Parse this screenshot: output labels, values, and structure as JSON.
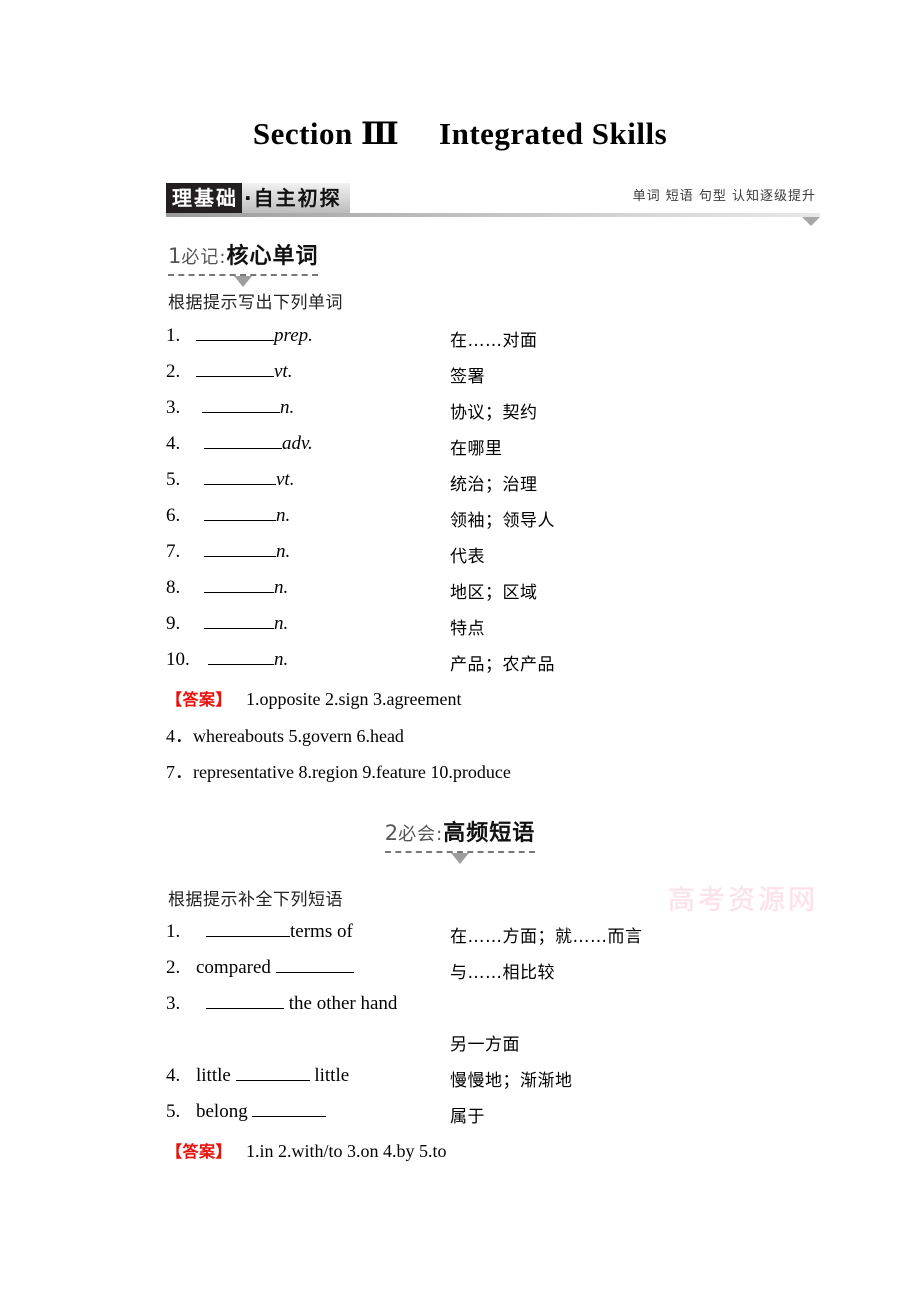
{
  "page": {
    "title": "Section Ⅲ  Integrated Skills"
  },
  "banner": {
    "tag_dark": "理基础",
    "tag_light": "·自主初探",
    "caption": "单词 短语 句型  认知逐级提升",
    "triangle_color": "#a8a8a8"
  },
  "watermark": {
    "text": "高考资源网",
    "color": "#f9c9d8"
  },
  "section1": {
    "num": "1",
    "pre": "必记:",
    "main": "核心单词",
    "prompt": "根据提示写出下列单词",
    "items": [
      {
        "num": "1.",
        "pos": "prep.",
        "blank_width": 78,
        "gap": 0,
        "cn": "在……对面"
      },
      {
        "num": "2.",
        "pos": "vt.",
        "blank_width": 78,
        "gap": 0,
        "cn": "签署"
      },
      {
        "num": "3.",
        "pos": "n.",
        "blank_width": 78,
        "gap": 6,
        "cn": "协议；契约"
      },
      {
        "num": "4.",
        "pos": "adv.",
        "blank_width": 78,
        "gap": 8,
        "cn": "在哪里"
      },
      {
        "num": "5.",
        "pos": "vt.",
        "blank_width": 72,
        "gap": 8,
        "cn": "统治；治理"
      },
      {
        "num": "6.",
        "pos": "n.",
        "blank_width": 72,
        "gap": 8,
        "cn": "领袖；领导人"
      },
      {
        "num": "7.",
        "pos": "n.",
        "blank_width": 72,
        "gap": 8,
        "cn": "代表"
      },
      {
        "num": "8.",
        "pos": "n.",
        "blank_width": 70,
        "gap": 8,
        "cn": "地区；区域"
      },
      {
        "num": "9.",
        "pos": "n.",
        "blank_width": 70,
        "gap": 8,
        "cn": "特点"
      },
      {
        "num": "10.",
        "pos": "n.",
        "blank_width": 66,
        "gap": 12,
        "cn": "产品；农产品"
      }
    ],
    "answer_label": "【答案】",
    "answer_line1": "1.opposite   2.sign   3.agreement",
    "answer_line2": "4．whereabouts   5.govern   6.head",
    "answer_line3": "7．representative   8.region   9.feature   10.produce"
  },
  "section2": {
    "num": "2",
    "pre": "必会:",
    "main": "高频短语",
    "prompt": "根据提示补全下列短语",
    "items": [
      {
        "num": "1.",
        "pre_text": "",
        "blank_width": 84,
        "post_text": "terms of",
        "cn": "在……方面；就……而言"
      },
      {
        "num": "2.",
        "pre_text": "compared ",
        "blank_width": 78,
        "post_text": "",
        "cn": "与……相比较"
      },
      {
        "num": "3.",
        "pre_text": "",
        "blank_width": 78,
        "post_text": " the other hand",
        "cn": ""
      },
      {
        "num": "4.",
        "pre_text": "little ",
        "blank_width": 74,
        "post_text": " little",
        "cn": "慢慢地；渐渐地"
      },
      {
        "num": "5.",
        "pre_text": "belong ",
        "blank_width": 74,
        "post_text": "",
        "cn": "属于"
      }
    ],
    "item3_cn_wrapped": "另一方面",
    "answer_label": "【答案】",
    "answer_line1": "1.in   2.with/to   3.on   4.by   5.to"
  }
}
